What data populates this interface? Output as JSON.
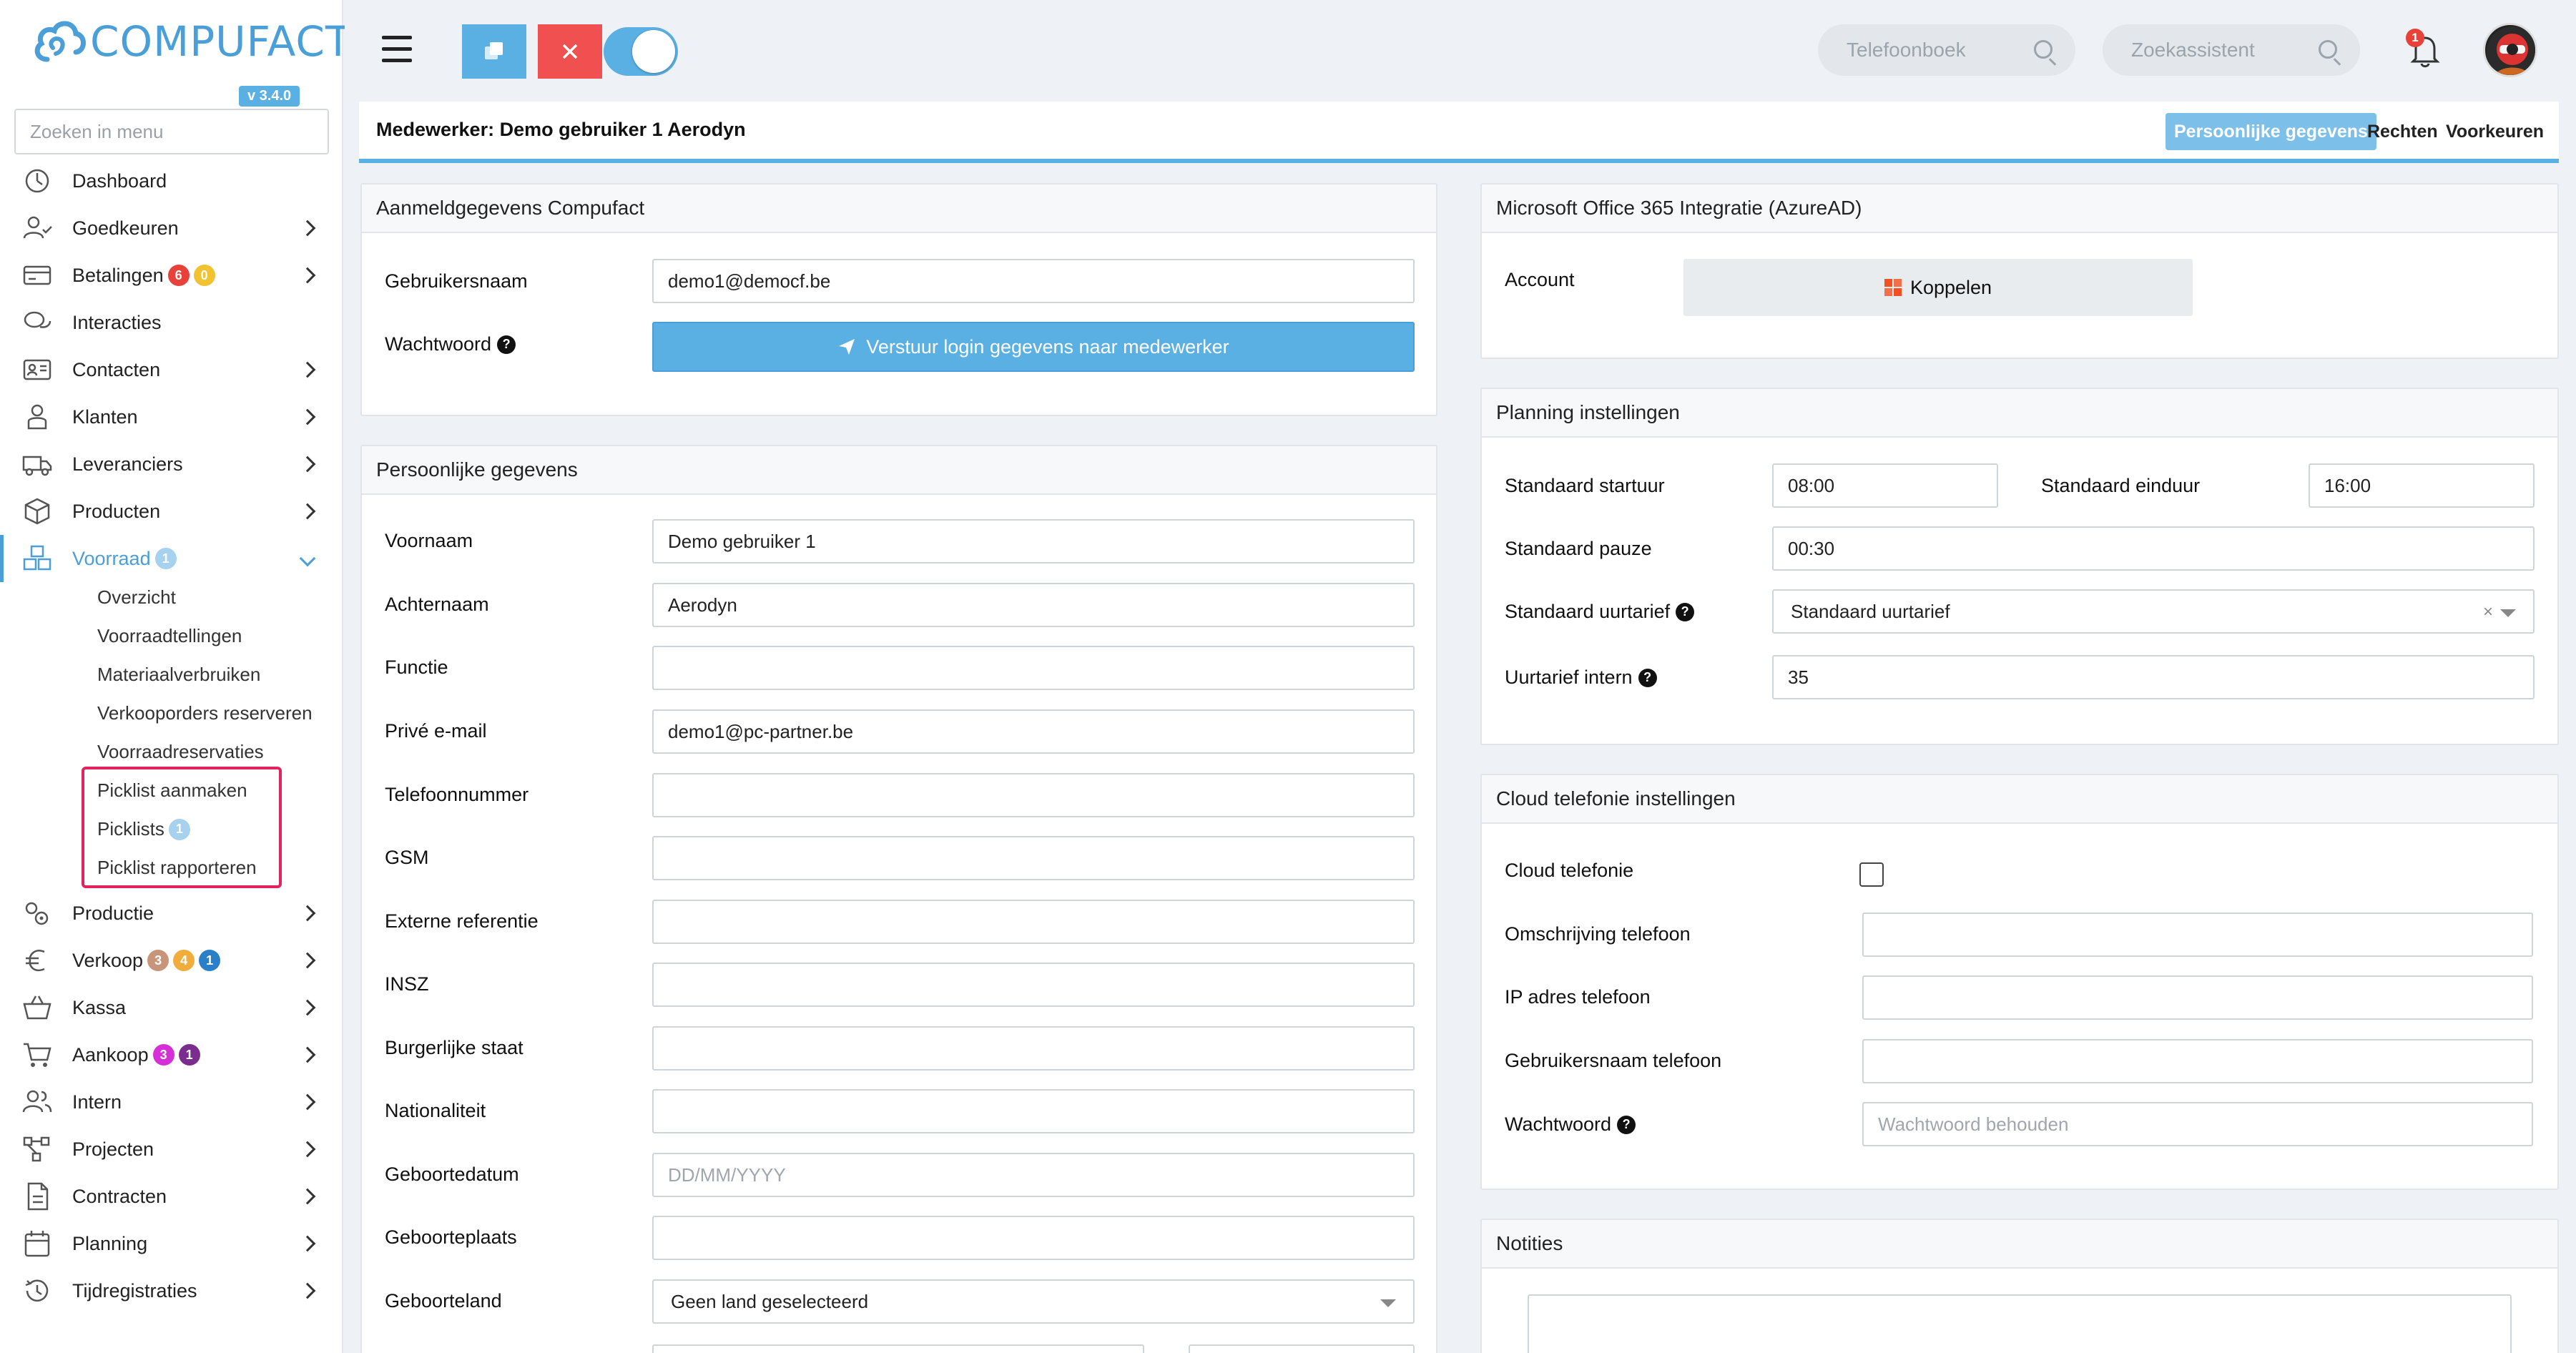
{
  "app": {
    "brand": "COMPUFACT",
    "version": "v 3.4.0",
    "menu_search_placeholder": "Zoeken in menu"
  },
  "sidebar": {
    "items": [
      {
        "label": "Dashboard",
        "icon": "dashboard-icon"
      },
      {
        "label": "Goedkeuren",
        "icon": "user-check-icon"
      },
      {
        "label": "Betalingen",
        "icon": "payments-icon",
        "badges": [
          "6",
          "0"
        ]
      },
      {
        "label": "Interacties",
        "icon": "chat-icon"
      },
      {
        "label": "Contacten",
        "icon": "contact-card-icon"
      },
      {
        "label": "Klanten",
        "icon": "customer-icon"
      },
      {
        "label": "Leveranciers",
        "icon": "truck-icon"
      },
      {
        "label": "Producten",
        "icon": "box-icon"
      },
      {
        "label": "Voorraad",
        "icon": "boxes-icon",
        "badges": [
          "1"
        ]
      },
      {
        "label": "Productie",
        "icon": "gears-icon"
      },
      {
        "label": "Verkoop",
        "icon": "euro-icon",
        "badges": [
          "3",
          "4",
          "1"
        ]
      },
      {
        "label": "Kassa",
        "icon": "basket-icon"
      },
      {
        "label": "Aankoop",
        "icon": "cart-icon",
        "badges": [
          "3",
          "1"
        ]
      },
      {
        "label": "Intern",
        "icon": "users-icon"
      },
      {
        "label": "Projecten",
        "icon": "project-icon"
      },
      {
        "label": "Contracten",
        "icon": "contract-icon"
      },
      {
        "label": "Planning",
        "icon": "calendar-icon"
      },
      {
        "label": "Tijdregistraties",
        "icon": "history-icon"
      }
    ],
    "voorraad_sub": [
      {
        "label": "Overzicht"
      },
      {
        "label": "Voorraadtellingen"
      },
      {
        "label": "Materiaalverbruiken"
      },
      {
        "label": "Verkooporders reserveren"
      },
      {
        "label": "Voorraadreservaties"
      },
      {
        "label": "Picklist aanmaken"
      },
      {
        "label": "Picklists",
        "badge": "1"
      },
      {
        "label": "Picklist rapporteren"
      }
    ]
  },
  "topbar": {
    "search_phonebook": "Telefoonboek",
    "search_assistant": "Zoekassistent",
    "notifications_count": "1"
  },
  "header": {
    "title": "Medewerker: Demo gebruiker 1 Aerodyn",
    "tabs": [
      "Persoonlijke gegevens",
      "Rechten",
      "Voorkeuren"
    ]
  },
  "login_panel": {
    "title": "Aanmeldgegevens Compufact",
    "username_label": "Gebruikersnaam",
    "username_value": "demo1@democf.be",
    "password_label": "Wachtwoord",
    "send_button": "Verstuur login gegevens naar medewerker"
  },
  "personal_panel": {
    "title": "Persoonlijke gegevens",
    "fields": [
      {
        "label": "Voornaam",
        "value": "Demo gebruiker 1"
      },
      {
        "label": "Achternaam",
        "value": "Aerodyn"
      },
      {
        "label": "Functie",
        "value": ""
      },
      {
        "label": "Privé e-mail",
        "value": "demo1@pc-partner.be"
      },
      {
        "label": "Telefoonnummer",
        "value": ""
      },
      {
        "label": "GSM",
        "value": ""
      },
      {
        "label": "Externe referentie",
        "value": ""
      },
      {
        "label": "INSZ",
        "value": ""
      },
      {
        "label": "Burgerlijke staat",
        "value": ""
      },
      {
        "label": "Nationaliteit",
        "value": ""
      },
      {
        "label": "Geboortedatum",
        "value": "",
        "placeholder": "DD/MM/YYYY"
      },
      {
        "label": "Geboorteplaats",
        "value": ""
      },
      {
        "label": "Geboorteland",
        "value": "Geen land geselecteerd"
      }
    ]
  },
  "office_panel": {
    "title": "Microsoft Office 365 Integratie (AzureAD)",
    "account_label": "Account",
    "connect_button": "Koppelen"
  },
  "planning_panel": {
    "title": "Planning instellingen",
    "start_label": "Standaard startuur",
    "start_value": "08:00",
    "end_label": "Standaard einduur",
    "end_value": "16:00",
    "pause_label": "Standaard pauze",
    "pause_value": "00:30",
    "rate_label": "Standaard uurtarief",
    "rate_value": "Standaard uurtarief",
    "internal_label": "Uurtarief intern",
    "internal_value": "35"
  },
  "cloud_panel": {
    "title": "Cloud telefonie instellingen",
    "enabled_label": "Cloud telefonie",
    "enabled": false,
    "desc_label": "Omschrijving telefoon",
    "ip_label": "IP adres telefoon",
    "user_label": "Gebruikersnaam telefoon",
    "password_label": "Wachtwoord",
    "password_placeholder": "Wachtwoord behouden"
  },
  "notes_panel": {
    "title": "Notities"
  },
  "colors": {
    "accent": "#5ab0e2",
    "danger": "#f05050",
    "highlight": "#e0245e",
    "badge_red": "#e8413a",
    "badge_yellow": "#f1c232",
    "badge_tan": "#c9957a",
    "badge_orange": "#f0ad3c",
    "badge_blue": "#2a7fc9",
    "badge_magenta": "#d72fd7",
    "badge_purple": "#7b2d8e",
    "badge_light_blue": "#a6d1ef"
  }
}
